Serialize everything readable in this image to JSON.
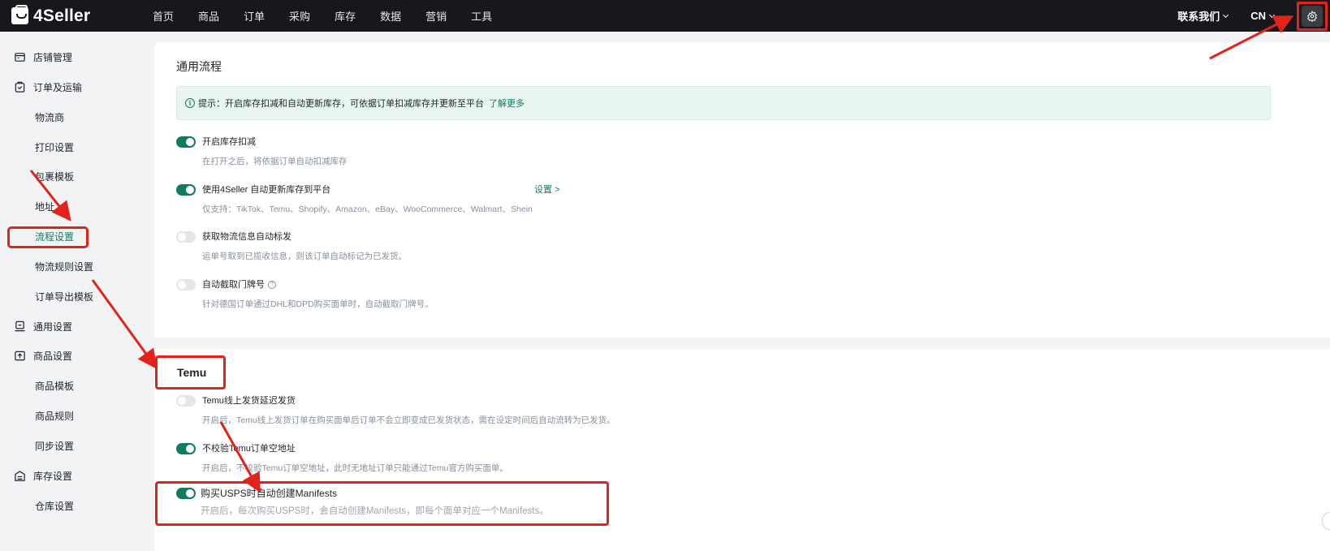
{
  "header": {
    "logo": "4Seller",
    "nav": [
      "首页",
      "商品",
      "订单",
      "采购",
      "库存",
      "数据",
      "营销",
      "工具"
    ],
    "contact": "联系我们",
    "language": "CN"
  },
  "sidebar": {
    "items": [
      {
        "label": "店铺管理",
        "icon": "store-icon",
        "kind": "group"
      },
      {
        "label": "订单及运输",
        "icon": "order-icon",
        "kind": "group"
      },
      {
        "label": "物流商",
        "kind": "sub"
      },
      {
        "label": "打印设置",
        "kind": "sub"
      },
      {
        "label": "包裹模板",
        "kind": "sub"
      },
      {
        "label": "地址",
        "kind": "sub"
      },
      {
        "label": "流程设置",
        "kind": "sub",
        "active": true
      },
      {
        "label": "物流规则设置",
        "kind": "sub"
      },
      {
        "label": "订单导出模板",
        "kind": "sub"
      },
      {
        "label": "通用设置",
        "icon": "settings-icon",
        "kind": "group"
      },
      {
        "label": "商品设置",
        "icon": "product-icon",
        "kind": "group"
      },
      {
        "label": "商品模板",
        "kind": "sub"
      },
      {
        "label": "商品规则",
        "kind": "sub"
      },
      {
        "label": "同步设置",
        "kind": "sub"
      },
      {
        "label": "库存设置",
        "icon": "inventory-icon",
        "kind": "group"
      },
      {
        "label": "仓库设置",
        "kind": "sub"
      }
    ]
  },
  "general": {
    "title": "通用流程",
    "tip": "提示：开启库存扣减和自动更新库存，可依据订单扣减库存并更新至平台",
    "tip_link": "了解更多",
    "settings": [
      {
        "label": "开启库存扣减",
        "desc": "在打开之后，将依据订单自动扣减库存",
        "on": true
      },
      {
        "label": "使用4Seller 自动更新库存到平台",
        "desc": "仅支持：TikTok、Temu、Shopify、Amazon、eBay、WooCommerce、Walmart、Shein",
        "on": true,
        "link": "设置 >"
      },
      {
        "label": "获取物流信息自动标发",
        "desc": "运单号取到已揽收信息，则该订单自动标记为已发货。",
        "on": false
      },
      {
        "label": "自动截取门牌号",
        "desc": "针对德国订单通过DHL和DPD购买面单时，自动截取门牌号。",
        "on": false,
        "help": "?"
      }
    ]
  },
  "temu": {
    "title": "Temu",
    "settings": [
      {
        "label": "Temu线上发货延迟发货",
        "desc": "开启后，Temu线上发货订单在购买面单后订单不会立即变成已发货状态，需在设定时间后自动流转为已发货。",
        "on": false
      },
      {
        "label": "不校验Temu订单空地址",
        "desc": "开启后，不校验Temu订单空地址，此时无地址订单只能通过Temu官方购买面单。",
        "on": true
      },
      {
        "label": "购买USPS时自动创建Manifests",
        "desc": "开启后，每次购买USPS时，会自动创建Manifests，即每个面单对应一个Manifests。",
        "on": true
      }
    ]
  },
  "colors": {
    "accent": "#0f7b63",
    "topbar": "#16181c",
    "annotation": "#e2231a"
  }
}
